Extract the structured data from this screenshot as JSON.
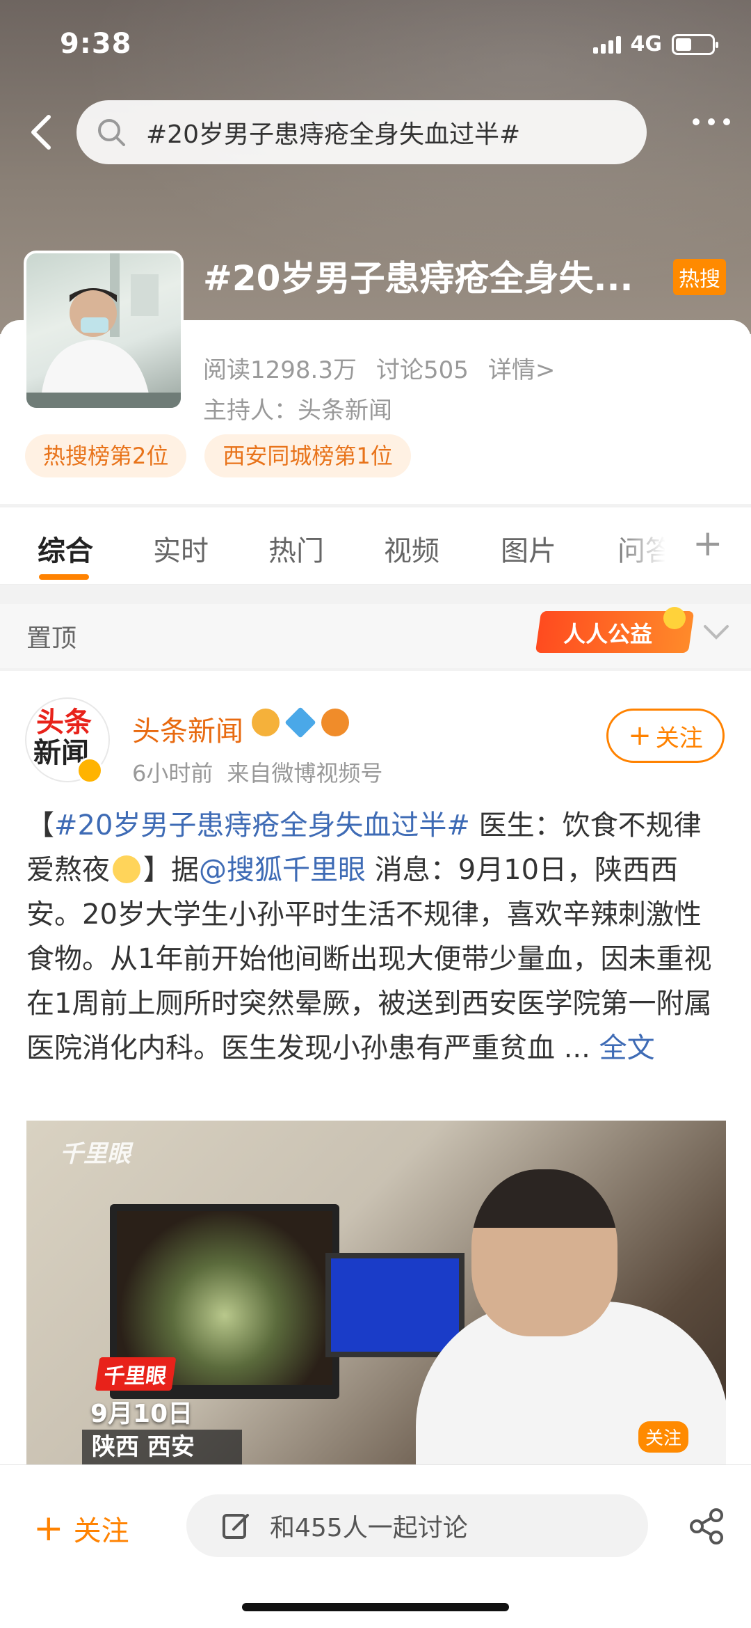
{
  "status_bar": {
    "time": "9:38",
    "network": "4G"
  },
  "search": {
    "query": "#20岁男子患痔疮全身失血过半#"
  },
  "topic": {
    "title": "#20岁男子患痔疮全身失...",
    "hot_badge": "热搜",
    "reads": "阅读1298.3万",
    "discussions": "讨论505",
    "details_link": "详情>",
    "host": "主持人：头条新闻",
    "rank_tags": [
      "热搜榜第2位",
      "西安同城榜第1位"
    ]
  },
  "tabs": [
    {
      "label": "综合",
      "active": true
    },
    {
      "label": "实时",
      "active": false
    },
    {
      "label": "热门",
      "active": false
    },
    {
      "label": "视频",
      "active": false
    },
    {
      "label": "图片",
      "active": false
    },
    {
      "label": "问答",
      "active": false
    }
  ],
  "pinned": {
    "label": "置顶",
    "charity_banner": "人人公益"
  },
  "post": {
    "avatar_text_top": "头条",
    "avatar_text_bottom": "新闻",
    "author": "头条新闻",
    "time": "6小时前",
    "source": "来自微博视频号",
    "follow_label": "关注",
    "text_bracket_open": "【",
    "hashtag": "#20岁男子患痔疮全身失血过半#",
    "text_part1": " 医生：饮食不规律爱熬夜",
    "text_part2": "】据",
    "mention": "@搜狐千里眼",
    "text_part3": " 消息：9月10日，陕西西安。20岁大学生小孙平时生活不规律，喜欢辛辣刺激性食物。从1年前开始他间断出现大便带少量血，因未重视在1周前上厕所时突然晕厥，被送到西安医学院第一附属医院消化内科。医生发现小孙患有严重贫血 ...",
    "full_text_link": "全文",
    "video": {
      "watermark_top": "千里眼",
      "brand_tag": "千里眼",
      "date": "9月10日",
      "location": "陕西 西安",
      "corner_follow": "关注"
    }
  },
  "bottom_bar": {
    "follow_label": "关注",
    "discuss_placeholder": "和455人一起讨论"
  },
  "colors": {
    "accent": "#ff8200",
    "link": "#3e6bb5",
    "hot": "#ff8a00"
  }
}
